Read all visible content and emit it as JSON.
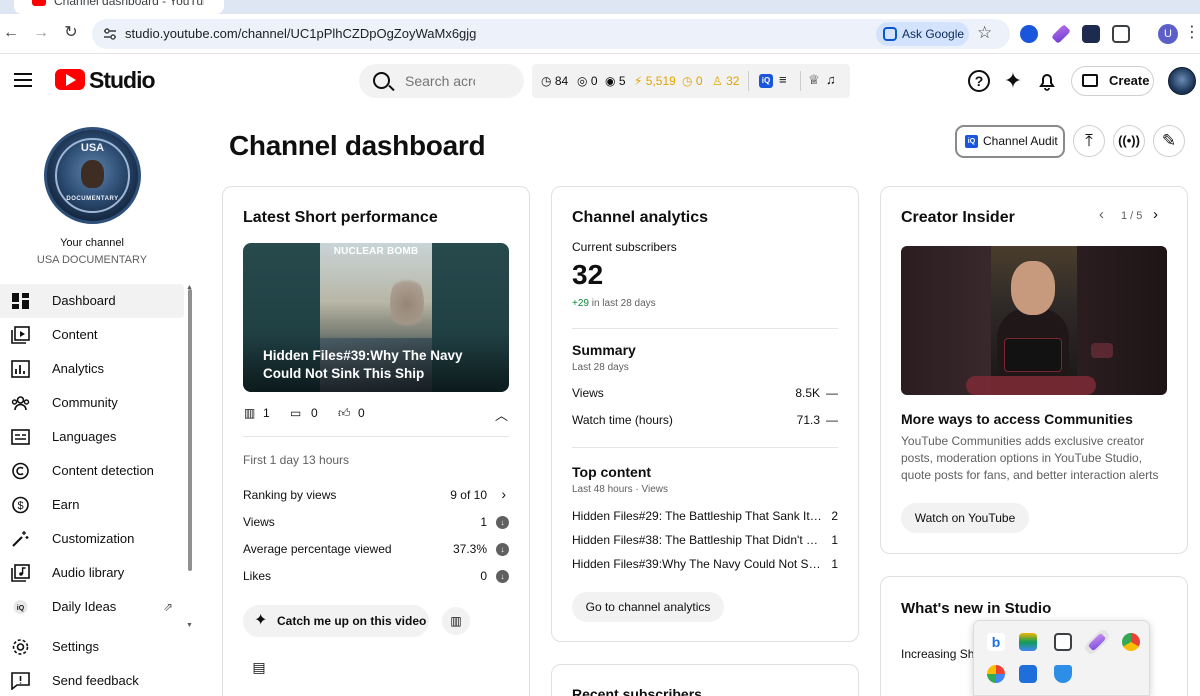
{
  "browser": {
    "tab_title": "Channel dashboard - YouTube",
    "url": "studio.youtube.com/channel/UC1pPlhCZDpOgZoyWaMx6gjg",
    "ask_google": "Ask Google",
    "profile_initial": "U"
  },
  "header": {
    "logo_text": "Studio",
    "search_placeholder": "Search acro",
    "vidiq": {
      "views": "84",
      "likes": "0",
      "watching": "5",
      "coins": "5,519",
      "clock": "0",
      "subs": "32",
      "iq_label": "iQ"
    },
    "create_label": "Create"
  },
  "sidebar": {
    "your_channel": "Your channel",
    "channel_name": "USA DOCUMENTARY",
    "avatar_top_text": "USA",
    "avatar_bottom_text": "DOCUMENTARY",
    "items": [
      {
        "label": "Dashboard",
        "icon": "dashboard-icon",
        "active": true
      },
      {
        "label": "Content",
        "icon": "content-icon"
      },
      {
        "label": "Analytics",
        "icon": "analytics-icon"
      },
      {
        "label": "Community",
        "icon": "community-icon"
      },
      {
        "label": "Languages",
        "icon": "languages-icon"
      },
      {
        "label": "Content detection",
        "icon": "copyright-icon"
      },
      {
        "label": "Earn",
        "icon": "earn-icon"
      },
      {
        "label": "Customization",
        "icon": "customization-icon"
      },
      {
        "label": "Audio library",
        "icon": "audio-library-icon"
      },
      {
        "label": "Daily Ideas",
        "icon": "vidiq-icon"
      }
    ],
    "bottom_items": [
      {
        "label": "Settings",
        "icon": "gear-icon"
      },
      {
        "label": "Send feedback",
        "icon": "feedback-icon"
      }
    ]
  },
  "main": {
    "page_title": "Channel dashboard",
    "channel_audit": "Channel Audit",
    "audit_iq": "iQ"
  },
  "short_perf": {
    "title": "Latest Short performance",
    "thumb_overlay": "NUCLEAR BOMB",
    "video_title": "Hidden Files#39:Why The Navy Could Not Sink This Ship",
    "views_count": "1",
    "comments_count": "0",
    "likes_count": "0",
    "age": "First 1 day 13 hours",
    "rows": [
      {
        "label": "Ranking by views",
        "value": "9 of 10"
      },
      {
        "label": "Views",
        "value": "1"
      },
      {
        "label": "Average percentage viewed",
        "value": "37.3%"
      },
      {
        "label": "Likes",
        "value": "0"
      }
    ],
    "catch_up": "Catch me up on this video"
  },
  "analytics": {
    "title": "Channel analytics",
    "subs_label": "Current subscribers",
    "subs_count": "32",
    "subs_change_plus": "+29",
    "subs_change_text": " in last 28 days",
    "summary_title": "Summary",
    "summary_sub": "Last 28 days",
    "summary_rows": [
      {
        "label": "Views",
        "value": "8.5K",
        "trend": "—"
      },
      {
        "label": "Watch time (hours)",
        "value": "71.3",
        "trend": "—"
      }
    ],
    "top_title": "Top content",
    "top_sub": "Last 48 hours · Views",
    "top_rows": [
      {
        "title": "Hidden Files#29: The Battleship That Sank Its...",
        "views": "2"
      },
      {
        "title": "Hidden Files#38: The Battleship That Didn't K...",
        "views": "1"
      },
      {
        "title": "Hidden Files#39:Why The Navy Could Not Sin...",
        "views": "1"
      }
    ],
    "goto": "Go to channel analytics",
    "recent_subs_title": "Recent subscribers"
  },
  "insider": {
    "title": "Creator Insider",
    "pager": "1 / 5",
    "video_title": "More ways to access Communities",
    "description": "YouTube Communities adds exclusive creator posts, moderation options in YouTube Studio, quote posts for fans, and better interaction alerts",
    "watch": "Watch on YouTube"
  },
  "whats_new": {
    "title": "What's new in Studio",
    "item": "Increasing Sh"
  },
  "colors": {
    "brand_red": "#ff0000",
    "accent_blue": "#1a56db",
    "positive_green": "#0b8a3a"
  }
}
